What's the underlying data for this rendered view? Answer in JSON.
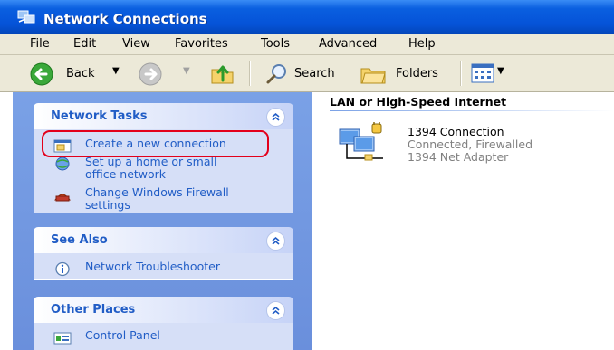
{
  "window": {
    "title": "Network Connections"
  },
  "menu": [
    "File",
    "Edit",
    "View",
    "Favorites",
    "Tools",
    "Advanced",
    "Help"
  ],
  "toolbar": {
    "back": "Back",
    "search": "Search",
    "folders": "Folders"
  },
  "tasks_panel": {
    "title": "Network Tasks",
    "items": [
      {
        "label": "Create a new connection",
        "icon": "new-connection-icon"
      },
      {
        "label": "Set up a home or small office network",
        "line1": "Set up a home or small",
        "line2": "office network",
        "icon": "home-network-icon"
      },
      {
        "label": "Change Windows Firewall settings",
        "line1": "Change Windows Firewall",
        "line2": "settings",
        "icon": "firewall-icon"
      }
    ]
  },
  "see_also_panel": {
    "title": "See Also",
    "items": [
      {
        "label": "Network Troubleshooter",
        "icon": "info-icon"
      }
    ]
  },
  "other_places_panel": {
    "title": "Other Places",
    "items": [
      {
        "label": "Control Panel",
        "icon": "control-panel-icon"
      }
    ]
  },
  "content": {
    "group_title": "LAN or High-Speed Internet",
    "connection": {
      "name": "1394 Connection",
      "status": "Connected, Firewalled",
      "device": "1394 Net Adapter"
    }
  },
  "colors": {
    "title_blue": "#0553d8",
    "task_link": "#215dc6",
    "pane_blue": "#7aa1e6",
    "highlight_red": "#e3001b"
  }
}
